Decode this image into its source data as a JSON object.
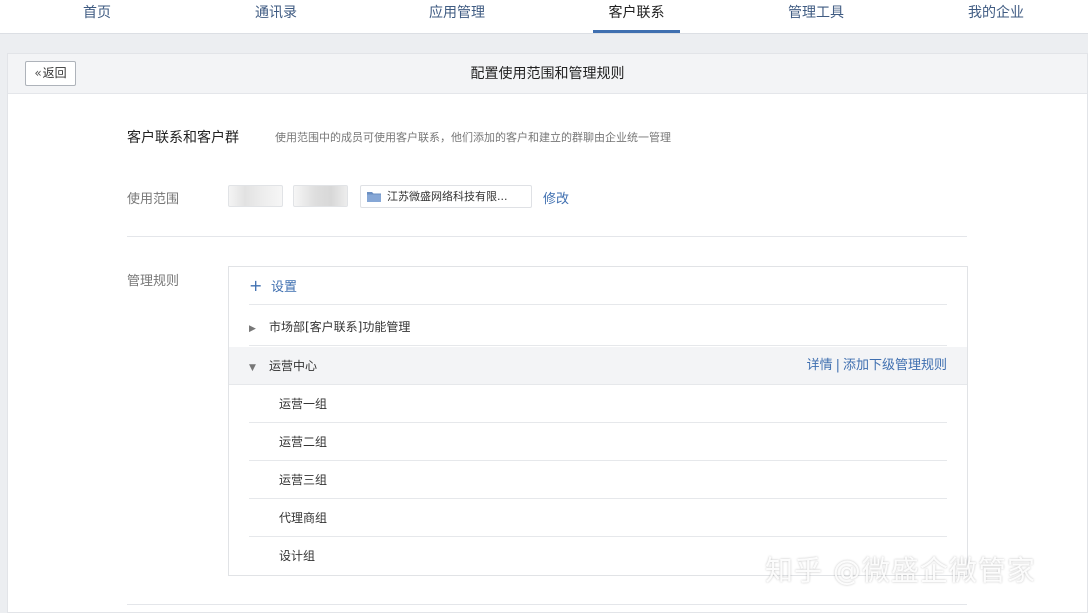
{
  "nav": {
    "items": [
      {
        "label": "首页"
      },
      {
        "label": "通讯录"
      },
      {
        "label": "应用管理"
      },
      {
        "label": "客户联系"
      },
      {
        "label": "管理工具"
      },
      {
        "label": "我的企业"
      }
    ],
    "active_index": 3
  },
  "header": {
    "back_label": "返回",
    "title": "配置使用范围和管理规则"
  },
  "section": {
    "title": "客户联系和客户群",
    "description": "使用范围中的成员可使用客户联系，他们添加的客户和建立的群聊由企业统一管理"
  },
  "scope": {
    "label": "使用范围",
    "department": "江苏微盛网络科技有限...",
    "modify_label": "修改"
  },
  "rules": {
    "label": "管理规则",
    "set_label": "设置",
    "items": [
      {
        "label": "市场部[客户联系]功能管理",
        "expanded": false
      },
      {
        "label": "运营中心",
        "expanded": true,
        "detail_label": "详情",
        "separator": "|",
        "add_sub_label": "添加下级管理规则"
      }
    ],
    "children": [
      "运营一组",
      "运营二组",
      "运营三组",
      "代理商组",
      "设计组"
    ]
  },
  "watermark": "知乎 @微盛企微管家",
  "colors": {
    "link": "#3f6fb0",
    "nav_text": "#3f5b82",
    "active_underline": "#3f6fb0",
    "page_bg": "#eceef1"
  },
  "icons": {
    "back": "double-chevron-left",
    "folder": "folder-icon",
    "add": "plus-icon",
    "collapsed": "triangle-right",
    "expanded": "triangle-down"
  }
}
